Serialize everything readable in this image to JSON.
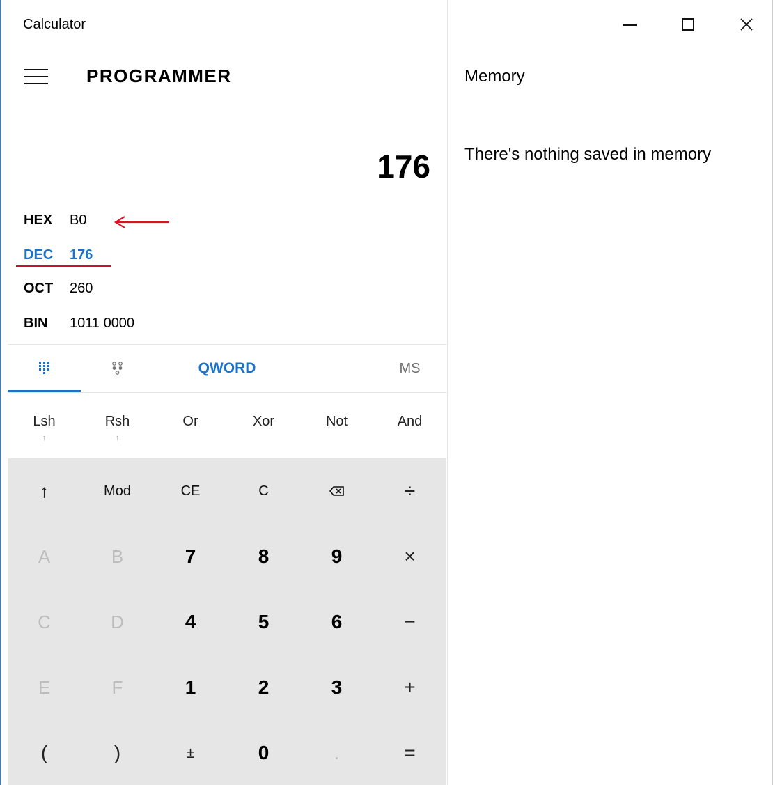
{
  "window": {
    "title": "Calculator"
  },
  "header": {
    "mode": "PROGRAMMER"
  },
  "display": {
    "value": "176"
  },
  "radix": [
    {
      "label": "HEX",
      "value": "B0"
    },
    {
      "label": "DEC",
      "value": "176"
    },
    {
      "label": "OCT",
      "value": "260"
    },
    {
      "label": "BIN",
      "value": "1011 0000"
    }
  ],
  "modes": {
    "word_size": "QWORD",
    "memory_store": "MS"
  },
  "bitwise": [
    {
      "label": "Lsh",
      "sub": "↑"
    },
    {
      "label": "Rsh",
      "sub": "↑"
    },
    {
      "label": "Or",
      "sub": ""
    },
    {
      "label": "Xor",
      "sub": ""
    },
    {
      "label": "Not",
      "sub": ""
    },
    {
      "label": "And",
      "sub": ""
    }
  ],
  "keys": {
    "row1": [
      "↑",
      "Mod",
      "CE",
      "C",
      "⌫",
      "÷"
    ],
    "row2": [
      "A",
      "B",
      "7",
      "8",
      "9",
      "×"
    ],
    "row3": [
      "C",
      "D",
      "4",
      "5",
      "6",
      "−"
    ],
    "row4": [
      "E",
      "F",
      "1",
      "2",
      "3",
      "+"
    ],
    "row5": [
      "(",
      ")",
      "±",
      "0",
      ".",
      "="
    ]
  },
  "memory": {
    "title": "Memory",
    "empty_message": "There's nothing saved in memory"
  },
  "colors": {
    "accent": "#1a73c8",
    "annotation": "#e0101c",
    "keypad_bg": "#e6e6e6"
  },
  "icons": {
    "minimize": "minimize-icon",
    "maximize": "maximize-icon",
    "close": "close-icon",
    "menu": "hamburger-icon",
    "full_keypad": "full-keypad-icon",
    "bit_toggle": "bit-toggle-keypad-icon",
    "backspace": "backspace-icon"
  }
}
